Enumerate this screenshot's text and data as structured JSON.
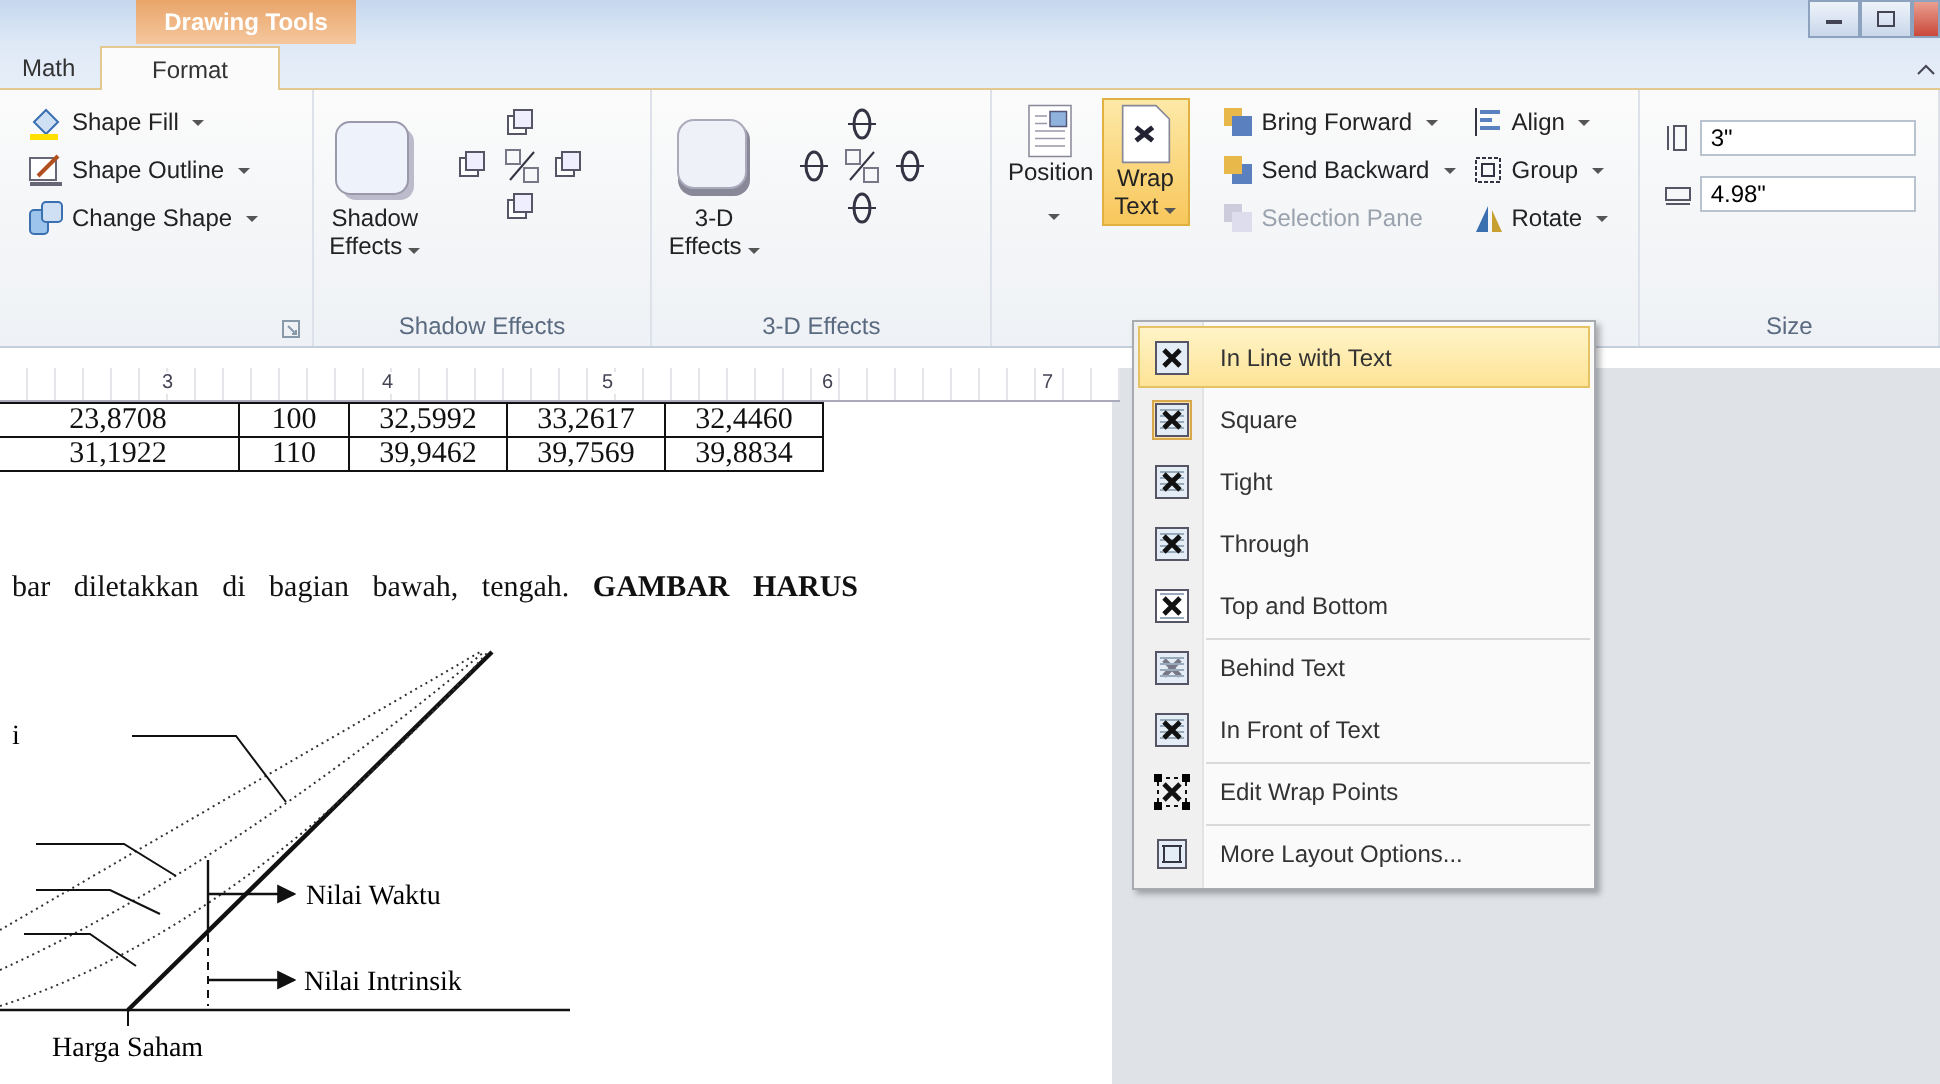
{
  "title_bar": {
    "context_tab": "Drawing Tools"
  },
  "tabs": [
    {
      "label": "Math",
      "selected": false
    },
    {
      "label": "Format",
      "selected": true
    }
  ],
  "ribbon": {
    "groups": [
      {
        "kind": "shape_styles",
        "buttons": [
          {
            "label": "Shape Fill",
            "dropdown": true
          },
          {
            "label": "Shape Outline",
            "dropdown": true
          },
          {
            "label": "Change Shape",
            "dropdown": true
          }
        ]
      },
      {
        "kind": "effects",
        "label": "Shadow Effects",
        "lines": [
          "Shadow",
          "Effects"
        ]
      },
      {
        "kind": "effects",
        "label": "3-D Effects",
        "lines": [
          "3-D",
          "Effects"
        ]
      },
      {
        "kind": "arrange",
        "big_buttons": [
          {
            "lines": [
              "Position"
            ],
            "active": false
          },
          {
            "lines": [
              "Wrap",
              "Text"
            ],
            "active": true
          }
        ],
        "columns": [
          [
            {
              "label": "Bring Forward",
              "disabled": false
            },
            {
              "label": "Send Backward",
              "disabled": false
            },
            {
              "label": "Selection Pane",
              "disabled": true
            }
          ],
          [
            {
              "label": "Align",
              "disabled": false
            },
            {
              "label": "Group",
              "disabled": false
            },
            {
              "label": "Rotate",
              "disabled": false
            }
          ]
        ]
      },
      {
        "kind": "size",
        "label": "Size",
        "fields": [
          {
            "value": "3\""
          },
          {
            "value": "4.98\""
          }
        ]
      }
    ]
  },
  "ruler": {
    "numbers": [
      "3",
      "4",
      "5",
      "6",
      "7"
    ]
  },
  "table": {
    "rows": [
      [
        "23,8708",
        "100",
        "32,5992",
        "33,2617",
        "32,4460"
      ],
      [
        "31,1922",
        "110",
        "39,9462",
        "39,7569",
        "39,8834"
      ]
    ]
  },
  "paragraph": "bar diletakkan di bagian bawah, tengah. **GAMBAR HARUS**",
  "figure": {
    "labels": [
      "i",
      "Nilai Waktu",
      "Nilai Intrinsik",
      "Harga Saham"
    ]
  },
  "wrap_menu": {
    "items": [
      {
        "kind": "inline",
        "label": "In Line with Text",
        "selected": true,
        "checked": false,
        "divider_above": false
      },
      {
        "kind": "square",
        "label": "Square",
        "selected": false,
        "checked": true,
        "divider_above": false
      },
      {
        "kind": "tight",
        "label": "Tight",
        "selected": false,
        "checked": false,
        "divider_above": false
      },
      {
        "kind": "through",
        "label": "Through",
        "selected": false,
        "checked": false,
        "divider_above": false
      },
      {
        "kind": "top_bottom",
        "label": "Top and Bottom",
        "selected": false,
        "checked": false,
        "divider_above": false
      },
      {
        "kind": "behind",
        "label": "Behind Text",
        "selected": false,
        "checked": false,
        "divider_above": true
      },
      {
        "kind": "front",
        "label": "In Front of Text",
        "selected": false,
        "checked": false,
        "divider_above": false
      },
      {
        "kind": "edit_points",
        "label": "Edit Wrap Points",
        "selected": false,
        "checked": false,
        "divider_above": true
      },
      {
        "kind": "layout_options",
        "label": "More Layout Options...",
        "selected": false,
        "checked": false,
        "divider_above": true
      }
    ]
  }
}
